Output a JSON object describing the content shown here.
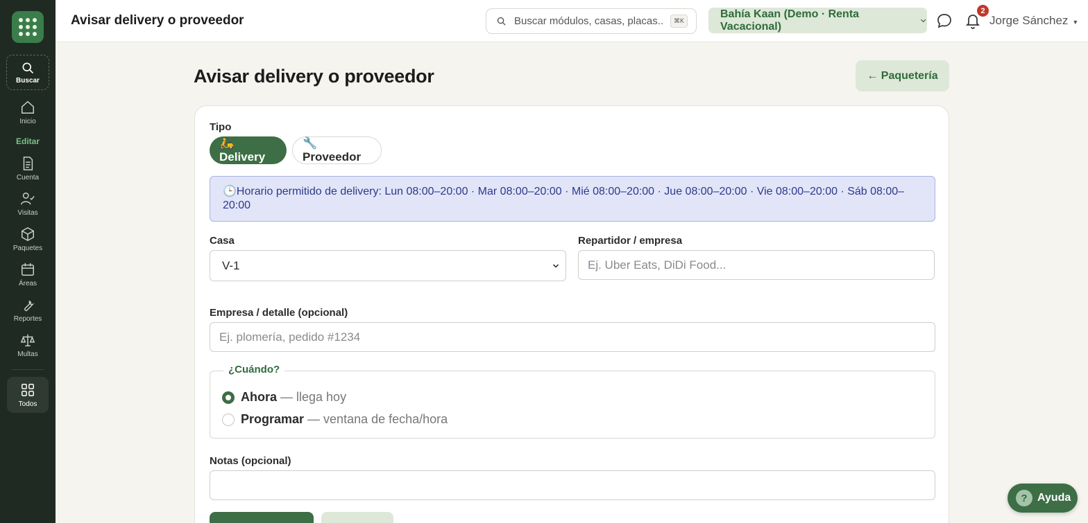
{
  "topbar": {
    "title": "Avisar delivery o proveedor",
    "search_placeholder": "Buscar módulos, casas, placas...",
    "search_shortcut": "⌘K",
    "community": "Bahía Kaan (Demo · Renta Vacacional)",
    "notifications_count": "2",
    "user_name": "Jorge Sánchez"
  },
  "sidebar": {
    "search_label": "Buscar",
    "section_edit": "Editar",
    "items": [
      {
        "label": "Inicio",
        "icon": "home-icon"
      },
      {
        "label": "Cuenta",
        "icon": "document-icon"
      },
      {
        "label": "Visitas",
        "icon": "user-check-icon"
      },
      {
        "label": "Paquetes",
        "icon": "package-icon"
      },
      {
        "label": "Áreas",
        "icon": "calendar-icon"
      },
      {
        "label": "Reportes",
        "icon": "wrench-icon"
      },
      {
        "label": "Multas",
        "icon": "scale-icon"
      }
    ],
    "all_label": "Todos"
  },
  "page": {
    "title": "Avisar delivery o proveedor",
    "back_button": "← Paquetería"
  },
  "form": {
    "tipo_label": "Tipo",
    "tipo_options": [
      "🛵Delivery",
      "🔧Proveedor"
    ],
    "tipo_selected": "Delivery",
    "notice": "🕒Horario permitido de delivery: Lun 08:00–20:00 · Mar 08:00–20:00 · Mié 08:00–20:00 · Jue 08:00–20:00 · Vie 08:00–20:00 · Sáb 08:00–20:00",
    "casa_label": "Casa",
    "casa_value": "V-1",
    "repartidor_label": "Repartidor / empresa",
    "repartidor_placeholder": "Ej. Uber Eats, DiDi Food...",
    "empresa_label": "Empresa / detalle (opcional)",
    "empresa_placeholder": "Ej. plomería, pedido #1234",
    "when_legend": "¿Cuándo?",
    "when_options": [
      {
        "main": "Ahora",
        "sub": "— llega hoy",
        "selected": true
      },
      {
        "main": "Programar",
        "sub": "— ventana de fecha/hora",
        "selected": false
      }
    ],
    "notas_label": "Notas (opcional)",
    "notas_value": ""
  },
  "help": {
    "label": "Ayuda",
    "icon": "?"
  },
  "colors": {
    "sidebar_bg": "#1f2a22",
    "accent": "#3d6e45",
    "accent_light": "#dde8d8",
    "notice_bg": "#e2e5f8",
    "badge": "#c0392b"
  }
}
